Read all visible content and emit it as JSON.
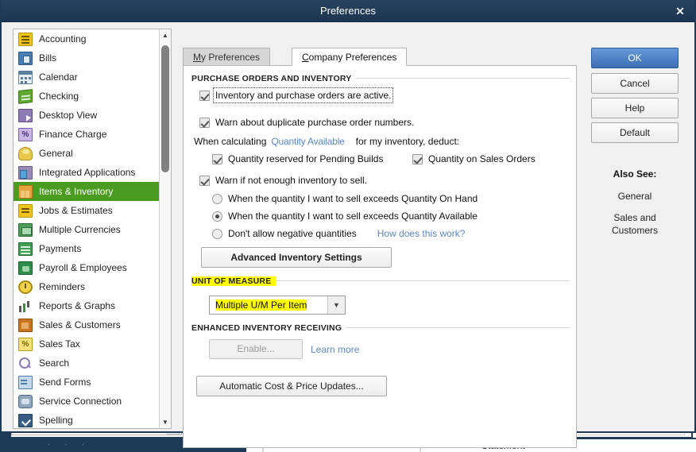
{
  "window": {
    "title": "Preferences",
    "close_icon": "close-icon"
  },
  "background": {
    "statement_label": "Statement",
    "tab_dots": "· · ·"
  },
  "sidebar": {
    "items": [
      {
        "label": "Accounting",
        "icon": "accounting-icon",
        "selected": false
      },
      {
        "label": "Bills",
        "icon": "bills-icon",
        "selected": false
      },
      {
        "label": "Calendar",
        "icon": "calendar-icon",
        "selected": false
      },
      {
        "label": "Checking",
        "icon": "checking-icon",
        "selected": false
      },
      {
        "label": "Desktop View",
        "icon": "desktop-view-icon",
        "selected": false
      },
      {
        "label": "Finance Charge",
        "icon": "finance-charge-icon",
        "selected": false
      },
      {
        "label": "General",
        "icon": "general-icon",
        "selected": false
      },
      {
        "label": "Integrated Applications",
        "icon": "integrated-applications-icon",
        "selected": false
      },
      {
        "label": "Items & Inventory",
        "icon": "items-inventory-icon",
        "selected": true
      },
      {
        "label": "Jobs & Estimates",
        "icon": "jobs-estimates-icon",
        "selected": false
      },
      {
        "label": "Multiple Currencies",
        "icon": "multiple-currencies-icon",
        "selected": false
      },
      {
        "label": "Payments",
        "icon": "payments-icon",
        "selected": false
      },
      {
        "label": "Payroll & Employees",
        "icon": "payroll-employees-icon",
        "selected": false
      },
      {
        "label": "Reminders",
        "icon": "reminders-icon",
        "selected": false
      },
      {
        "label": "Reports & Graphs",
        "icon": "reports-graphs-icon",
        "selected": false
      },
      {
        "label": "Sales & Customers",
        "icon": "sales-customers-icon",
        "selected": false
      },
      {
        "label": "Sales Tax",
        "icon": "sales-tax-icon",
        "selected": false
      },
      {
        "label": "Search",
        "icon": "search-icon",
        "selected": false
      },
      {
        "label": "Send Forms",
        "icon": "send-forms-icon",
        "selected": false
      },
      {
        "label": "Service Connection",
        "icon": "service-connection-icon",
        "selected": false
      },
      {
        "label": "Spelling",
        "icon": "spelling-icon",
        "selected": false
      }
    ],
    "scroll_up_icon": "triangle-up-icon",
    "scroll_down_icon": "triangle-down-icon"
  },
  "tabs": [
    {
      "label": "My Preferences",
      "active": false
    },
    {
      "label": "Company Preferences",
      "active": true
    }
  ],
  "content": {
    "purchase_orders_group": {
      "title": "PURCHASE ORDERS AND INVENTORY",
      "inventory_active": {
        "label": "Inventory and purchase orders are active.",
        "checked": true,
        "focused": true
      },
      "warn_duplicate_po": {
        "label": "Warn about duplicate purchase order numbers.",
        "checked": true
      },
      "when_calculating_prefix": "When calculating",
      "quantity_available_link": "Quantity Available",
      "when_calculating_suffix": "for my inventory, deduct:",
      "deduct_options": [
        {
          "label": "Quantity reserved for Pending Builds",
          "checked": true
        },
        {
          "label": "Quantity on Sales Orders",
          "checked": true
        }
      ],
      "warn_not_enough": {
        "label": "Warn if not enough inventory to sell.",
        "checked": true
      },
      "warn_radio_options": [
        {
          "label": "When the quantity I want to sell exceeds Quantity On Hand",
          "selected": false
        },
        {
          "label": "When the quantity I want to sell exceeds Quantity Available",
          "selected": true
        },
        {
          "label": "Don't allow negative quantities",
          "selected": false
        }
      ],
      "how_does_this_work_link": "How does this work?",
      "advanced_inventory_button": "Advanced Inventory Settings"
    },
    "unit_of_measure_group": {
      "title": "UNIT OF MEASURE",
      "title_highlighted": true,
      "combo_value": "Multiple U/M Per Item",
      "combo_highlighted": true,
      "combo_arrow_icon": "chevron-down-icon"
    },
    "enhanced_inventory_group": {
      "title": "ENHANCED INVENTORY RECEIVING",
      "enable_button": "Enable...",
      "enable_disabled": true,
      "learn_more_link": "Learn more"
    },
    "automatic_cost_button": "Automatic Cost & Price Updates..."
  },
  "right_panel": {
    "ok_button": "OK",
    "cancel_button": "Cancel",
    "help_button": "Help",
    "default_button": "Default",
    "also_see_label": "Also See:",
    "also_see_links": [
      "General",
      "Sales and Customers"
    ]
  },
  "colors": {
    "title_bar": "#1d3450",
    "selected_item": "#4a9c21",
    "ok_button": "#3d6fb5",
    "link": "#5b88c4",
    "highlight": "#ffff00"
  }
}
